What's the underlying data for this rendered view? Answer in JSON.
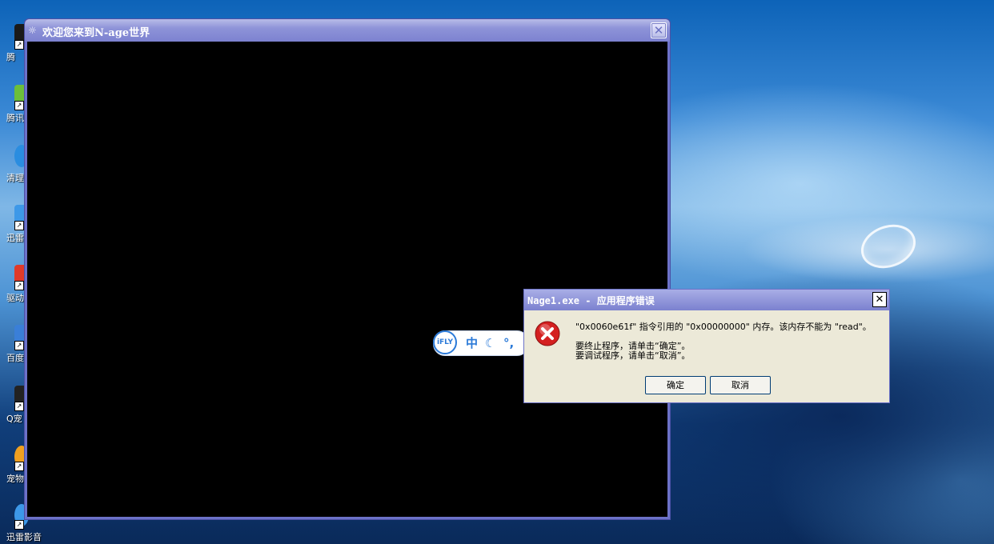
{
  "desktop": {
    "icons": [
      {
        "label": "腾",
        "color": "#1a1a1a"
      },
      {
        "label": "腾讯",
        "color": "#6cbf3a"
      },
      {
        "label": "清理",
        "color": "#2a8de0"
      },
      {
        "label": "迅雷",
        "color": "#3d98e8"
      },
      {
        "label": "驱动",
        "color": "#e03a2a"
      },
      {
        "label": "百度",
        "color": "#3a7fd8"
      },
      {
        "label": "Q宠",
        "color": "#222222"
      },
      {
        "label": "宠物",
        "color": "#f0a020"
      },
      {
        "label": "迅雷影音",
        "color": "#3d98e8"
      }
    ]
  },
  "game_window": {
    "title": "欢迎您来到N-age世界",
    "icon": "app-icon",
    "close_glyph": "✕"
  },
  "ime_toolbar": {
    "logo": "iFLY",
    "mode": "中",
    "moon_glyph": "☾",
    "punct_glyph": "°,"
  },
  "error_dialog": {
    "title": "Nage1.exe - 应用程序错误",
    "close_glyph": "✕",
    "message_line1": "\"0x0060e61f\" 指令引用的 \"0x00000000\" 内存。该内存不能为 \"read\"。",
    "message_line2": "要终止程序，请单击“确定”。",
    "message_line3": "要调试程序，请单击“取消”。",
    "ok_label": "确定",
    "cancel_label": "取消",
    "icon": "error-icon",
    "icon_color": "#d42020"
  }
}
